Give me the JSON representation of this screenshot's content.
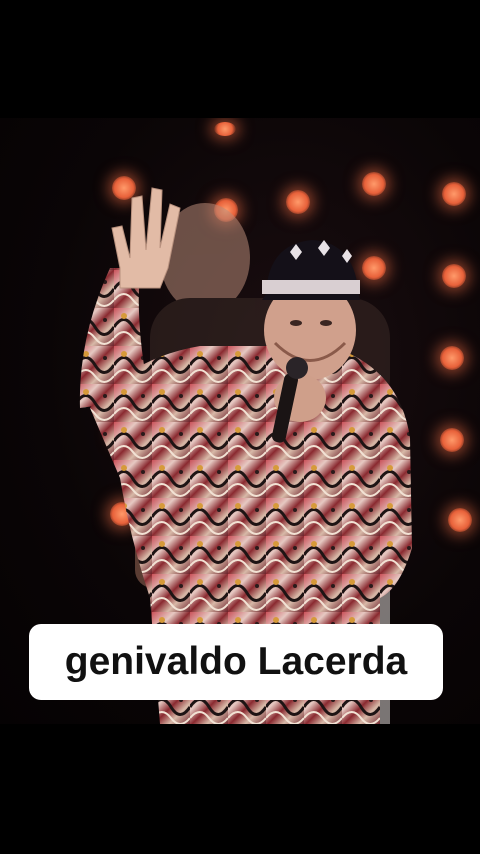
{
  "video": {
    "caption": "genivaldo Lacerda",
    "background_color": "#000000",
    "stage_light_color": "#e8613a"
  }
}
